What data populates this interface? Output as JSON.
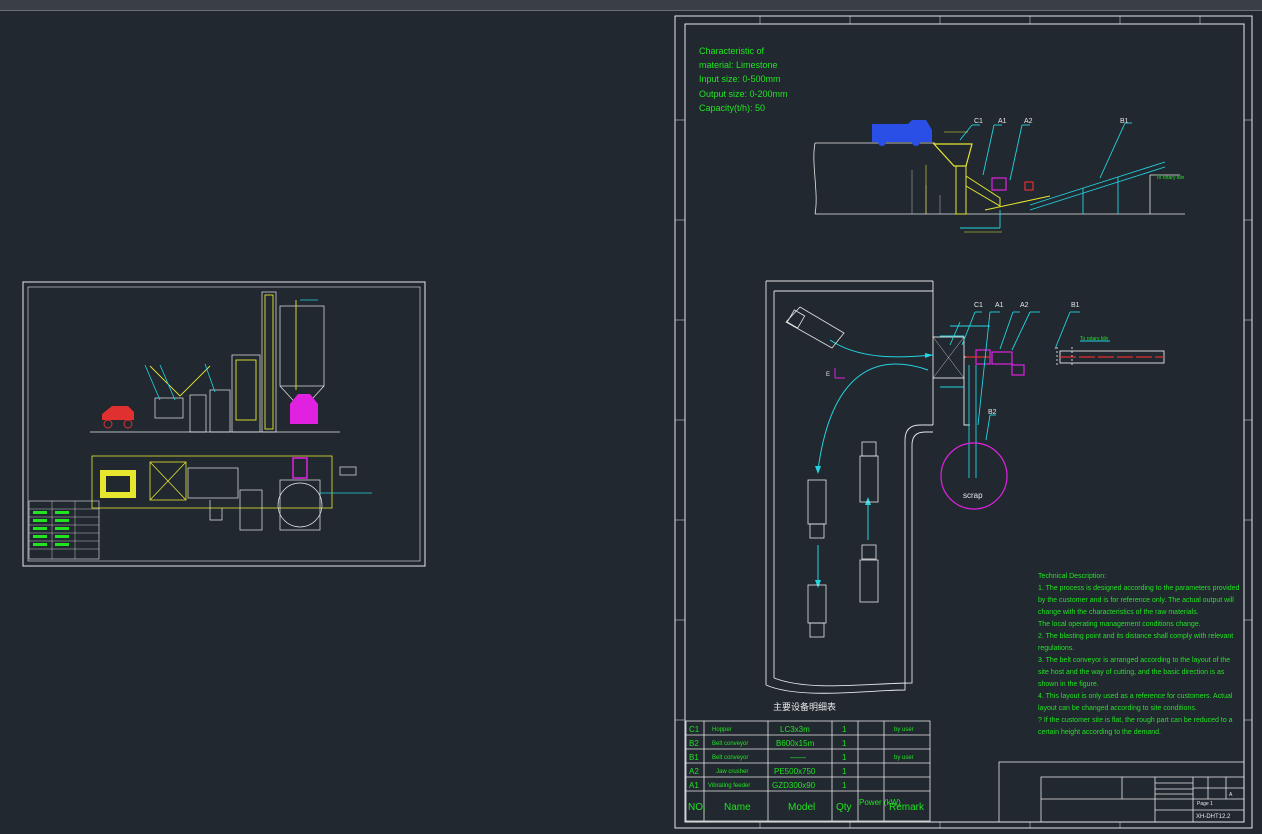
{
  "material": {
    "lines": [
      "Characteristic of",
      "material: Limestone",
      "Input size: 0-500mm",
      "Output size: 0-200mm",
      "Capacity(t/h): 50"
    ]
  },
  "labels": {
    "c1": "C1",
    "a1": "A1",
    "a2": "A2",
    "b1": "B1",
    "b2": "B2",
    "to_rotary": "To rotary kiln",
    "scrap": "scrap",
    "direction": "E",
    "table_title": "主要设备明细表"
  },
  "technical": {
    "title": "Technical Description:",
    "lines": [
      "1. The process is designed according to the parameters provided",
      "by the customer and is for reference only. The actual output will",
      "change with the characteristics of the raw materials.",
      "The local operating management conditions change.",
      "2. The blasting point and its distance shall comply with relevant",
      "regulations.",
      "3. The belt conveyor is arranged according to the layout of the",
      "site host and the way of cutting, and the basic direction is as",
      "shown in the figure.",
      "4. This layout is only used as a reference for customers. Actual",
      "layout can be changed according to site conditions.",
      "? If the customer site is flat, the rough part can be reduced to a",
      "certain height according to the demand."
    ]
  },
  "equipment": {
    "header": {
      "no": "NO.",
      "name": "Name",
      "model": "Model",
      "qty": "Qty",
      "power": "Power (kW)",
      "remark": "Remark"
    },
    "rows": [
      {
        "no": "C1",
        "name": "Hopper",
        "model": "LC3x3m",
        "qty": "1",
        "power": "",
        "remark": "by user"
      },
      {
        "no": "B2",
        "name": "Belt conveyor",
        "model": "B600x15m",
        "qty": "1",
        "power": "",
        "remark": ""
      },
      {
        "no": "B1",
        "name": "Belt conveyor",
        "model": "——",
        "qty": "1",
        "power": "",
        "remark": "by user"
      },
      {
        "no": "A2",
        "name": "Jaw crusher",
        "model": "PE500x750",
        "qty": "1",
        "power": "",
        "remark": ""
      },
      {
        "no": "A1",
        "name": "Vibrating feeder",
        "model": "GZD300x90",
        "qty": "1",
        "power": "",
        "remark": ""
      }
    ]
  },
  "titleblock": {
    "drawing_no": "XH-DHT12.2",
    "sheet": "Page 1",
    "stage": "A"
  },
  "colors": {
    "bg": "#212830",
    "line": "#e8e8e8",
    "text": "#21e321",
    "cyan": "#22d4e0",
    "yellow": "#e6e62e",
    "magenta": "#e022e0",
    "red": "#e03030",
    "blue": "#2a4fe6"
  }
}
